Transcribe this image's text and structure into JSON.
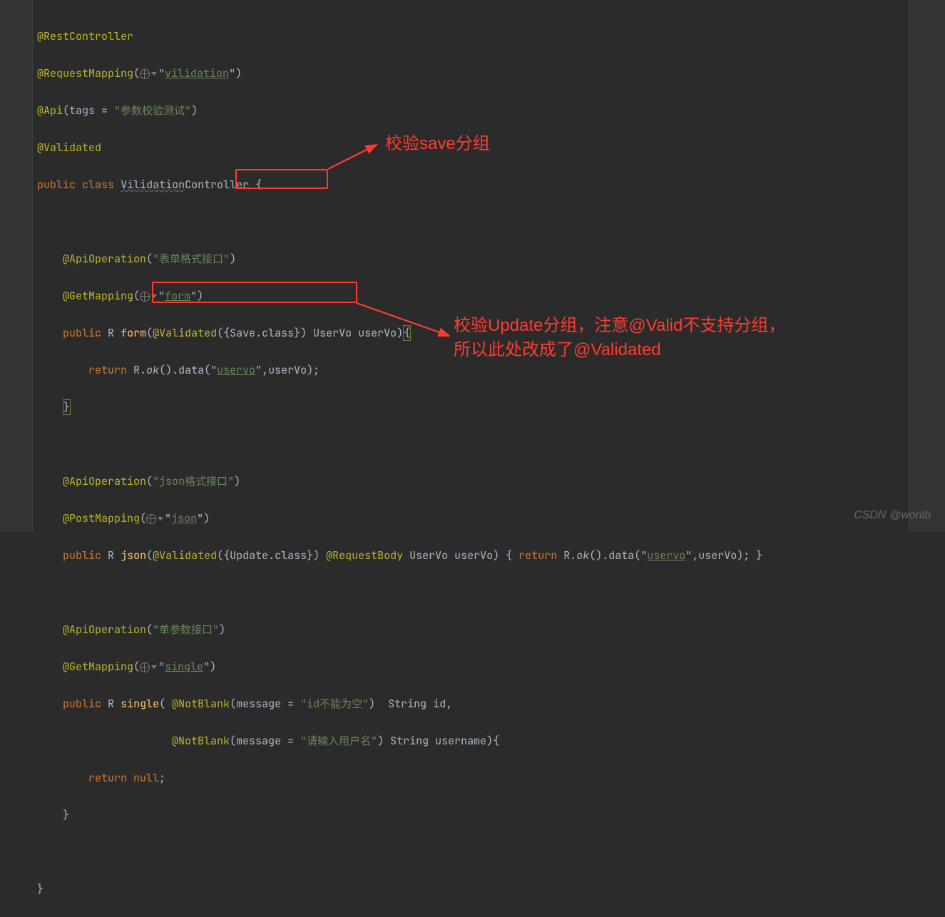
{
  "code": {
    "anno_rest_controller": "@RestController",
    "anno_request_mapping": "@RequestMapping",
    "req_mapping_value": "vilidation",
    "anno_api": "@Api",
    "api_tags": "tags = ",
    "api_value": "\"参数校验测试\"",
    "anno_validated": "@Validated",
    "kw_public": "public",
    "kw_class": "class",
    "cls_name": "Vilidation",
    "cls_suffix": "Controller {",
    "anno_api_op": "@ApiOperation",
    "api_op1": "\"表单格式接口\"",
    "anno_get": "@GetMapping",
    "get1_value": "form",
    "ret_type": "R",
    "m_form": "form",
    "validated_group1": "({Save.class})",
    "form_params": " UserVo userVo)",
    "kw_return": "return",
    "r_ok": "R.",
    "ok_call": "ok",
    "data_call": "().data(",
    "uservo_key": "uservo",
    "comma_uservo": ",userVo);",
    "api_op2": "\"json格式接口\"",
    "anno_post": "@PostMapping",
    "post_value": "json",
    "m_json": "json",
    "validated_group2": "({Update.class})",
    "anno_req_body": "@RequestBody",
    "json_params": " UserVo userVo) { ",
    "json_ret": " R.",
    "json_tail": ",userVo); }",
    "api_op3": "\"单参数接口\"",
    "get3_value": "single",
    "m_single": "single",
    "anno_notblank": "@NotBlank",
    "nb_msg": "(message = ",
    "nb1_val": "\"id不能为空\"",
    "nb2_val": "\"请输入用户名\"",
    "type_string": "String",
    "p_id": "id",
    "p_username": "username",
    "ret_null": "null"
  },
  "annotations": {
    "label1": "校验save分组",
    "label2_line1": "校验Update分组，注意@Valid不支持分组，",
    "label2_line2": "所以此处改成了@Validated"
  },
  "watermark": "CSDN @worilb"
}
